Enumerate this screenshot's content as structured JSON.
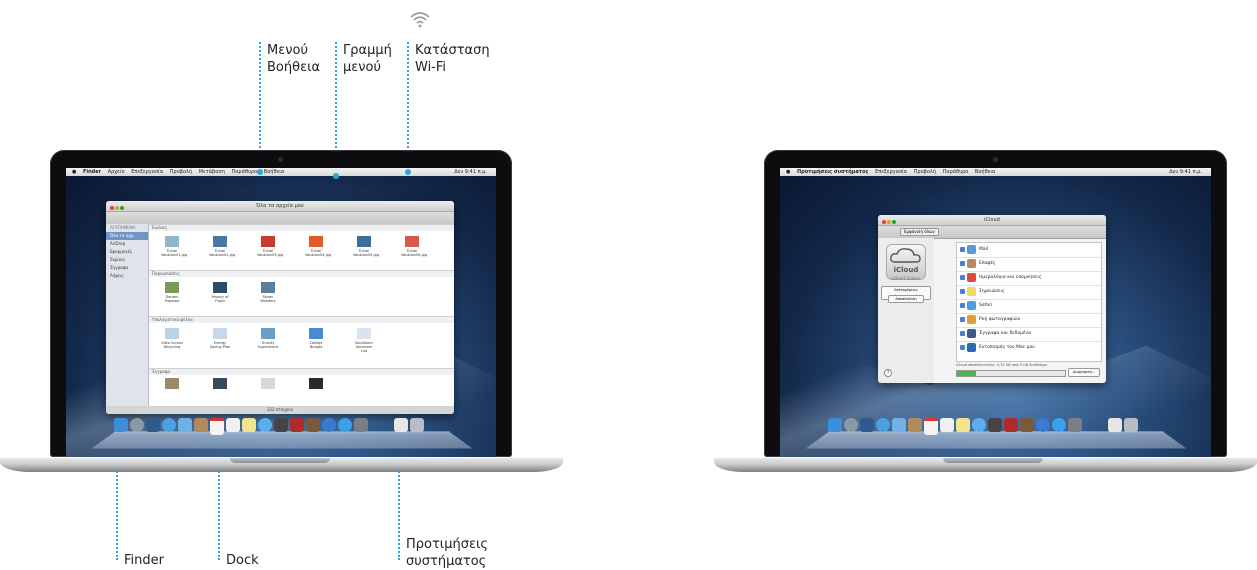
{
  "callouts": {
    "help_menu": "Μενού\nΒοήθεια",
    "menu_bar": "Γραμμή\nμενού",
    "wifi_status": "Κατάσταση\nWi‑Fi",
    "finder": "Finder",
    "dock": "Dock",
    "system_prefs": "Προτιμήσεις\nσυστήματος"
  },
  "left_screen": {
    "menubar": {
      "app": "Finder",
      "items": [
        "Αρχείο",
        "Επεξεργασία",
        "Προβολή",
        "Μετάβαση",
        "Παράθυρο",
        "Βοήθεια"
      ],
      "clock": "Δευ 9:41 π.μ."
    },
    "finder_window": {
      "title": "Όλα τα αρχεία μου",
      "sidebar_header": "ΑΓΑΠΗΜΕΝΑ",
      "sidebar_items": [
        "Όλα τα αρχ...",
        "AirDrop",
        "Εφαρμογές",
        "Σκρίνιο",
        "Έγγραφα",
        "Λήψεις"
      ],
      "sections": [
        {
          "name": "Εικόνες",
          "files": [
            "Tulum Vacation01.jpg",
            "Tulum Vacation02.jpg",
            "Tulum Vacation03.jpg",
            "Tulum Vacation04.jpg",
            "Tulum Vacation05.jpg",
            "Tulum Vacation06.jpg"
          ]
        },
        {
          "name": "Παρουσιάσεις",
          "files": [
            "Garden Proposal",
            "History of Flight",
            "Seven Wonders"
          ]
        },
        {
          "name": "Υπολογιστικά φύλλα",
          "files": [
            "Vista School Recycling",
            "Energy Saving Plan",
            "Gravity Experiment",
            "College Budget",
            "Southborn Volunteer List"
          ]
        },
        {
          "name": "Έγγραφα",
          "files": [
            "",
            "",
            "",
            ""
          ]
        }
      ],
      "footer": "322 στοιχεία"
    }
  },
  "right_screen": {
    "menubar": {
      "app": "Προτιμήσεις συστήματος",
      "items": [
        "Επεξεργασία",
        "Προβολή",
        "Παράθυρο",
        "Βοήθεια"
      ],
      "clock": "Δευ 9:41 π.μ."
    },
    "icloud_window": {
      "title": "iCloud",
      "show_all": "Εμφάνιση όλων",
      "logo_text": "iCloud",
      "account_name": "Gilbert Sobers",
      "details_button": "Λεπτομέρειες λογαριασμού",
      "signout_button": "Αποσύνδεση",
      "services": [
        "Mail",
        "Επαφές",
        "Ημερολόγια και υπομνήσεις",
        "Σημειώσεις",
        "Safari",
        "Ροή φωτογραφιών",
        "Έγγραφα και δεδομένα",
        "Εντοπισμός του Mac μου"
      ],
      "storage_text": "iCloud αποθηκευτικός: 4,74 GB από 5 GB διαθέσιμα",
      "manage_button": "Διαχείριση..."
    }
  },
  "colors": {
    "leader_line": "#2fa6d8",
    "bezel": "#0d0d0f"
  }
}
